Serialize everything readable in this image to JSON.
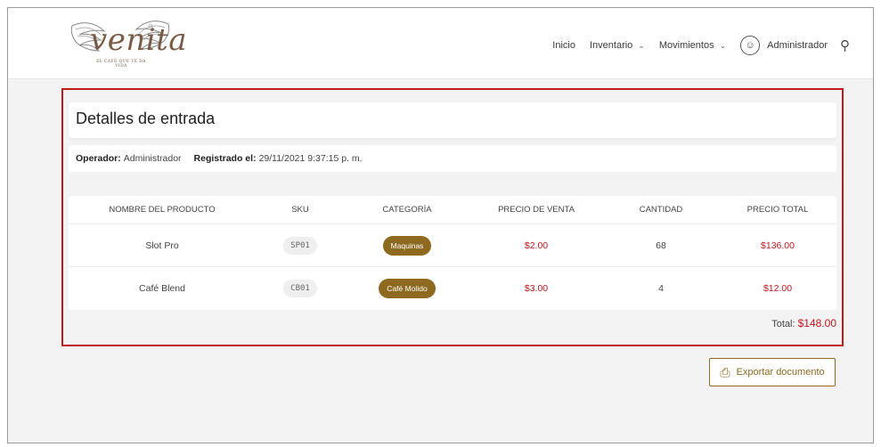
{
  "brand": {
    "name": "venita",
    "tagline": "EL CAFÉ QUE TE DA VIDA"
  },
  "nav": {
    "inicio": "Inicio",
    "inventario": "Inventario",
    "movimientos": "Movimientos",
    "user": "Administrador",
    "icons": {
      "chevron": "chevron-down-icon",
      "user": "user-circle-icon",
      "notifications": "bell-icon"
    }
  },
  "page": {
    "title": "Detalles de entrada"
  },
  "meta": {
    "operator_label": "Operador:",
    "operator_value": "Administrador",
    "registered_label": "Registrado el:",
    "registered_value": "29/11/2021 9:37:15 p. m."
  },
  "table": {
    "headers": [
      "NOMBRE DEL PRODUCTO",
      "SKU",
      "CATEGORÍA",
      "PRECIO DE VENTA",
      "CANTIDAD",
      "PRECIO TOTAL"
    ],
    "rows": [
      {
        "name": "Slot Pro",
        "sku": "SP01",
        "category": "Maquinas",
        "price": "$2.00",
        "qty": "68",
        "total": "$136.00"
      },
      {
        "name": "Café Blend",
        "sku": "CB01",
        "category": "Café Molido",
        "price": "$3.00",
        "qty": "4",
        "total": "$12.00"
      }
    ]
  },
  "summary": {
    "total_label": "Total:",
    "total_value": "$148.00"
  },
  "actions": {
    "export_label": "Exportar documento"
  },
  "colors": {
    "accent": "#8d6a1f",
    "price": "#c0161c",
    "highlight_border": "#c0161c"
  }
}
